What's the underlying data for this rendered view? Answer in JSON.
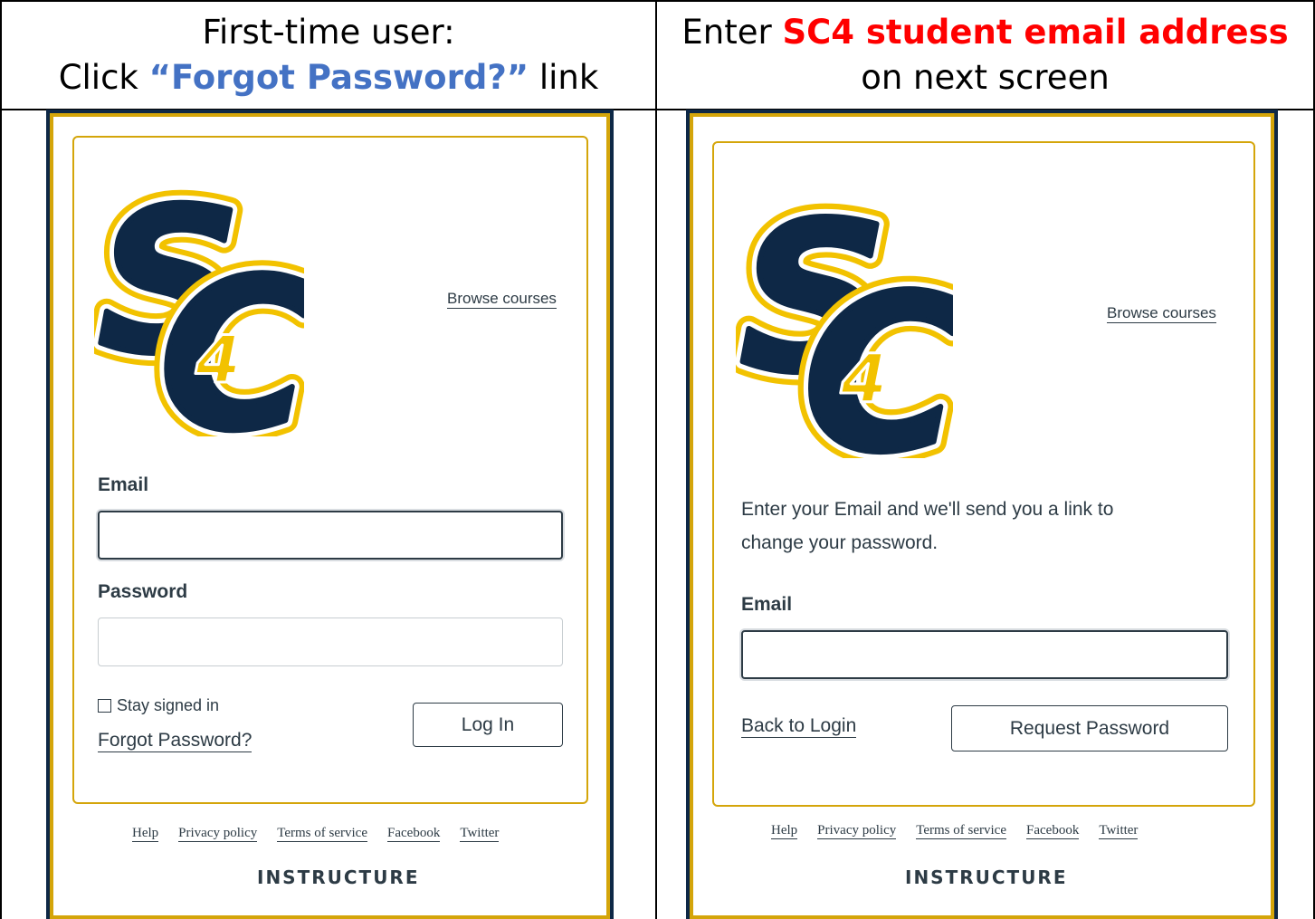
{
  "left_header": {
    "line1": "First-time user:",
    "line2_prefix": "Click ",
    "line2_highlight": "“Forgot Password?”",
    "line2_suffix": " link"
  },
  "right_header": {
    "line1_prefix": "Enter ",
    "line1_highlight": "SC4 student email address",
    "line2": "on next screen"
  },
  "colors": {
    "navy": "#0e2846",
    "gold": "#d4a50a",
    "text": "#2d3b45",
    "highlight_blue": "#4472c4",
    "highlight_red": "#ff0000"
  },
  "login_screen": {
    "logo_text": "SC4",
    "browse_courses": "Browse courses",
    "email_label": "Email",
    "email_value": "",
    "password_label": "Password",
    "password_value": "",
    "stay_signed_in": "Stay signed in",
    "forgot_password": "Forgot Password?",
    "login_button": "Log In",
    "footer": [
      "Help",
      "Privacy policy",
      "Terms of service",
      "Facebook",
      "Twitter"
    ],
    "brand": "INSTRUCTURE"
  },
  "reset_screen": {
    "logo_text": "SC4",
    "browse_courses": "Browse courses",
    "instructions_line1": "Enter your Email and we'll send you a link to",
    "instructions_line2": "change your password.",
    "email_label": "Email",
    "email_value": "",
    "back_to_login": "Back to Login",
    "request_button": "Request Password",
    "footer": [
      "Help",
      "Privacy policy",
      "Terms of service",
      "Facebook",
      "Twitter"
    ],
    "brand": "INSTRUCTURE"
  }
}
